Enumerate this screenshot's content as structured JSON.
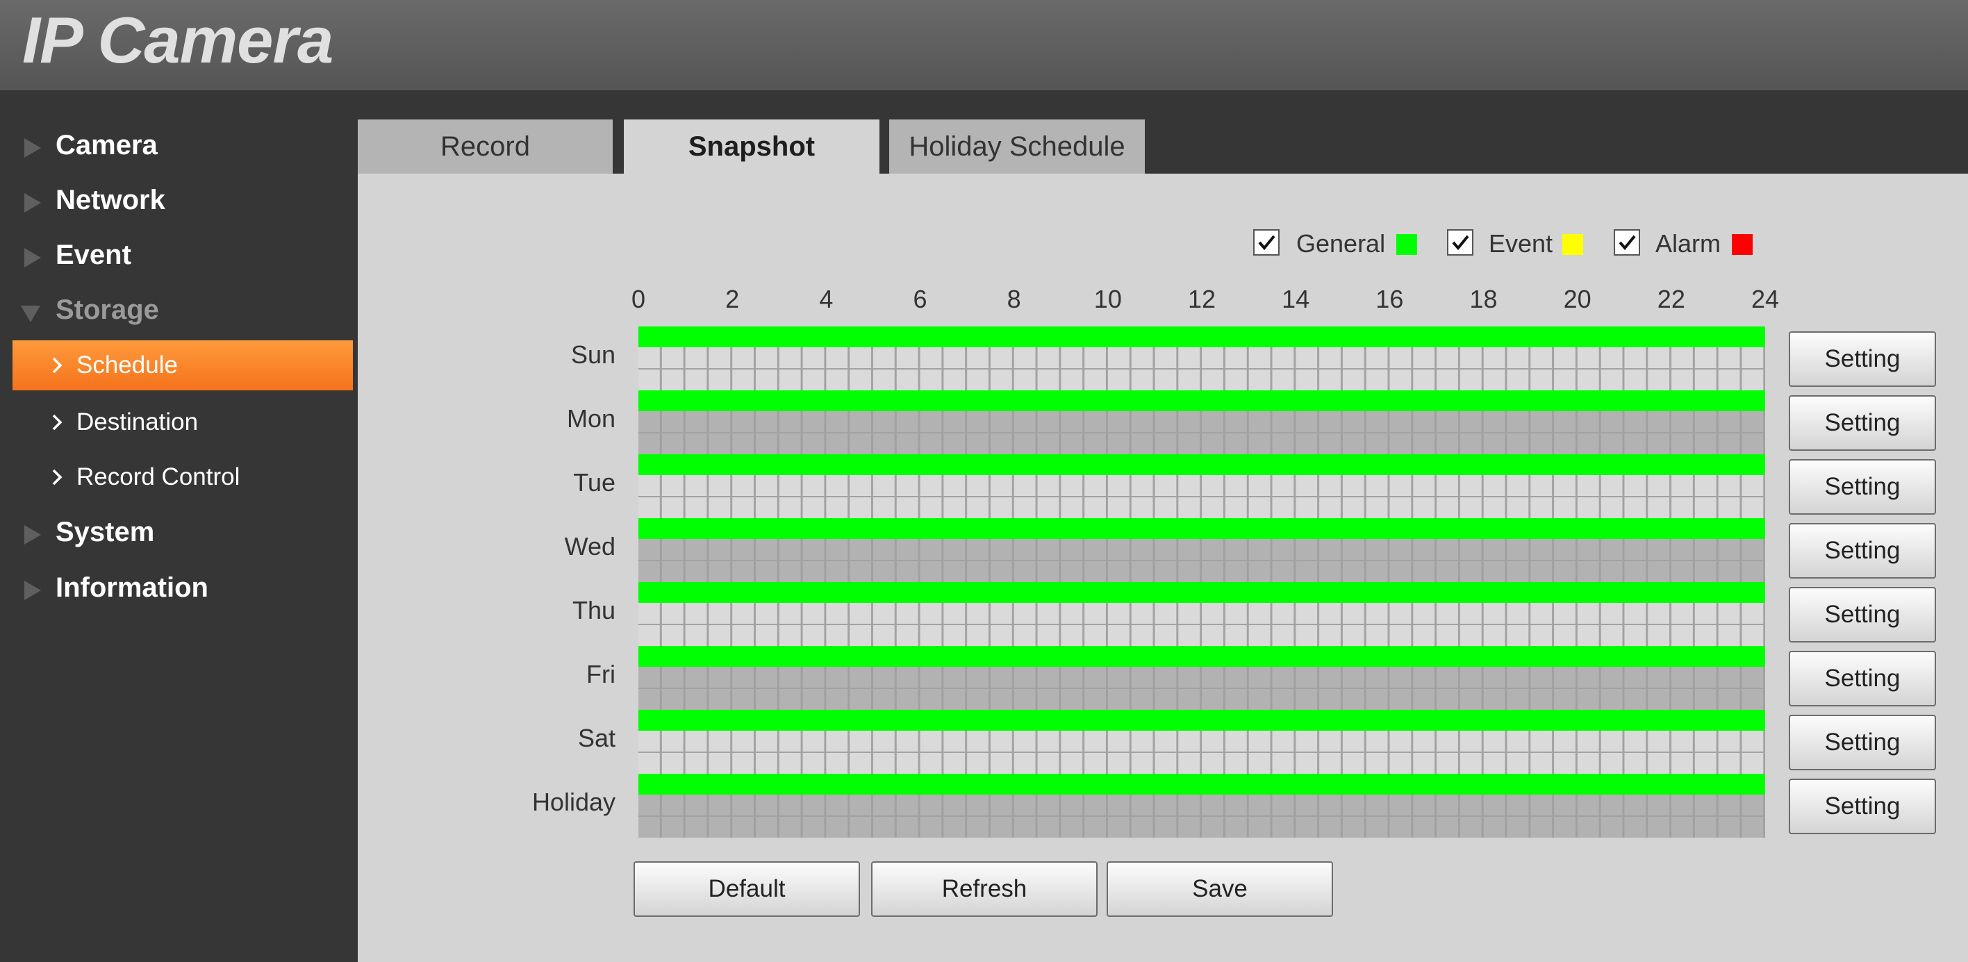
{
  "header": {
    "title": "IP Camera"
  },
  "sidebar": {
    "items": [
      {
        "label": "Camera"
      },
      {
        "label": "Network"
      },
      {
        "label": "Event"
      },
      {
        "label": "Storage"
      },
      {
        "label": "System"
      },
      {
        "label": "Information"
      }
    ],
    "storage_sub": [
      {
        "label": "Schedule",
        "active": true
      },
      {
        "label": "Destination"
      },
      {
        "label": "Record Control"
      }
    ]
  },
  "tabs": [
    {
      "label": "Record"
    },
    {
      "label": "Snapshot",
      "active": true
    },
    {
      "label": "Holiday Schedule"
    }
  ],
  "legend": [
    {
      "label": "General",
      "checked": true,
      "color": "#00ff00"
    },
    {
      "label": "Event",
      "checked": true,
      "color": "#ffff00"
    },
    {
      "label": "Alarm",
      "checked": true,
      "color": "#ff0000"
    }
  ],
  "hours": [
    "0",
    "2",
    "4",
    "6",
    "8",
    "10",
    "12",
    "14",
    "16",
    "18",
    "20",
    "22",
    "24"
  ],
  "days": [
    {
      "label": "Sun",
      "general_hours": [
        0,
        24
      ]
    },
    {
      "label": "Mon",
      "general_hours": [
        0,
        24
      ]
    },
    {
      "label": "Tue",
      "general_hours": [
        0,
        24
      ]
    },
    {
      "label": "Wed",
      "general_hours": [
        0,
        24
      ]
    },
    {
      "label": "Thu",
      "general_hours": [
        0,
        24
      ]
    },
    {
      "label": "Fri",
      "general_hours": [
        0,
        24
      ]
    },
    {
      "label": "Sat",
      "general_hours": [
        0,
        24
      ]
    },
    {
      "label": "Holiday",
      "general_hours": [
        0,
        24
      ]
    }
  ],
  "setting_label": "Setting",
  "buttons": {
    "default_label": "Default",
    "refresh_label": "Refresh",
    "save_label": "Save"
  },
  "colors": {
    "accent": "#f5731c",
    "general": "#00ff00",
    "event": "#ffff00",
    "alarm": "#ff0000"
  }
}
